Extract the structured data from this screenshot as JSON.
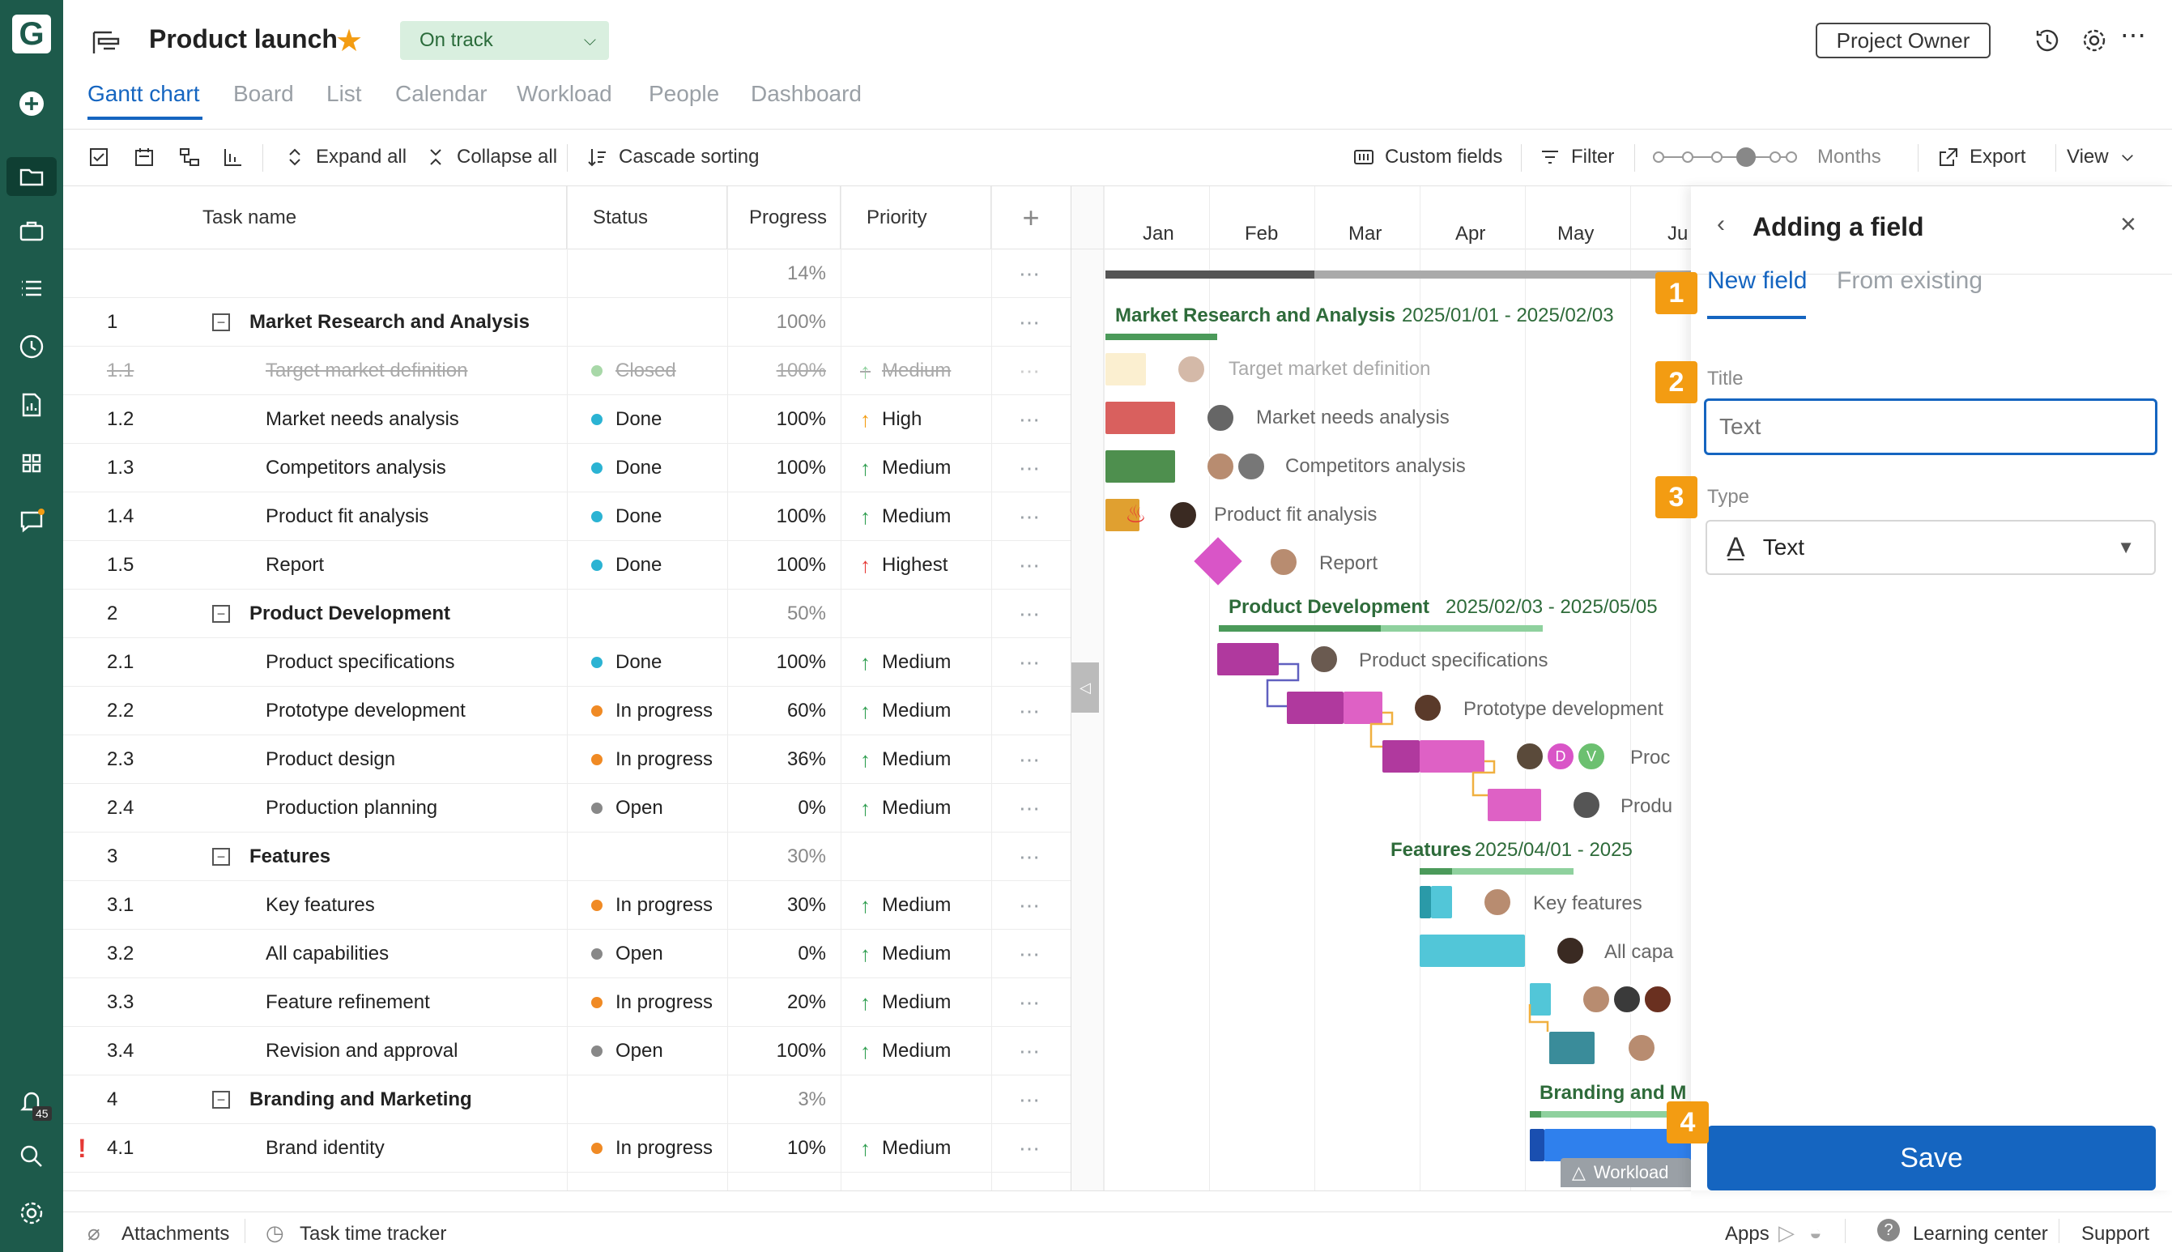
{
  "app": {
    "logo": "G",
    "title": "Product launch",
    "status": "On track",
    "owner_btn": "Project Owner",
    "notif_count": "45"
  },
  "tabs": [
    "Gantt chart",
    "Board",
    "List",
    "Calendar",
    "Workload",
    "People",
    "Dashboard"
  ],
  "toolbar": {
    "expand": "Expand all",
    "collapse": "Collapse all",
    "cascade": "Cascade sorting",
    "custom": "Custom fields",
    "filter": "Filter",
    "zoom": "Months",
    "export": "Export",
    "view": "View"
  },
  "columns": {
    "task": "Task name",
    "status": "Status",
    "progress": "Progress",
    "priority": "Priority"
  },
  "summary_progress": "14%",
  "rows": [
    {
      "num": "1",
      "name": "Market Research and Analysis",
      "status": "",
      "progress": "100%",
      "priority": "",
      "group": true,
      "dot": "",
      "pcolor": ""
    },
    {
      "num": "1.1",
      "name": "Target market definition",
      "status": "Closed",
      "progress": "100%",
      "priority": "Medium",
      "group": false,
      "dot": "#a8d8a8",
      "pcolor": "#8fd19e",
      "closed": true
    },
    {
      "num": "1.2",
      "name": "Market needs analysis",
      "status": "Done",
      "progress": "100%",
      "priority": "High",
      "group": false,
      "dot": "#2bb3d3",
      "pcolor": "#f39c12"
    },
    {
      "num": "1.3",
      "name": "Competitors analysis",
      "status": "Done",
      "progress": "100%",
      "priority": "Medium",
      "group": false,
      "dot": "#2bb3d3",
      "pcolor": "#2e9e4f"
    },
    {
      "num": "1.4",
      "name": "Product fit analysis",
      "status": "Done",
      "progress": "100%",
      "priority": "Medium",
      "group": false,
      "dot": "#2bb3d3",
      "pcolor": "#2e9e4f"
    },
    {
      "num": "1.5",
      "name": "Report",
      "status": "Done",
      "progress": "100%",
      "priority": "Highest",
      "group": false,
      "dot": "#2bb3d3",
      "pcolor": "#e53935"
    },
    {
      "num": "2",
      "name": "Product Development",
      "status": "",
      "progress": "50%",
      "priority": "",
      "group": true,
      "dot": "",
      "pcolor": ""
    },
    {
      "num": "2.1",
      "name": "Product specifications",
      "status": "Done",
      "progress": "100%",
      "priority": "Medium",
      "group": false,
      "dot": "#2bb3d3",
      "pcolor": "#2e9e4f"
    },
    {
      "num": "2.2",
      "name": "Prototype development",
      "status": "In progress",
      "progress": "60%",
      "priority": "Medium",
      "group": false,
      "dot": "#f08a24",
      "pcolor": "#2e9e4f"
    },
    {
      "num": "2.3",
      "name": "Product design",
      "status": "In progress",
      "progress": "36%",
      "priority": "Medium",
      "group": false,
      "dot": "#f08a24",
      "pcolor": "#2e9e4f"
    },
    {
      "num": "2.4",
      "name": "Production planning",
      "status": "Open",
      "progress": "0%",
      "priority": "Medium",
      "group": false,
      "dot": "#888",
      "pcolor": "#2e9e4f"
    },
    {
      "num": "3",
      "name": "Features",
      "status": "",
      "progress": "30%",
      "priority": "",
      "group": true,
      "dot": "",
      "pcolor": ""
    },
    {
      "num": "3.1",
      "name": "Key features",
      "status": "In progress",
      "progress": "30%",
      "priority": "Medium",
      "group": false,
      "dot": "#f08a24",
      "pcolor": "#2e9e4f"
    },
    {
      "num": "3.2",
      "name": "All capabilities",
      "status": "Open",
      "progress": "0%",
      "priority": "Medium",
      "group": false,
      "dot": "#888",
      "pcolor": "#2e9e4f"
    },
    {
      "num": "3.3",
      "name": "Feature refinement",
      "status": "In progress",
      "progress": "20%",
      "priority": "Medium",
      "group": false,
      "dot": "#f08a24",
      "pcolor": "#2e9e4f"
    },
    {
      "num": "3.4",
      "name": "Revision and approval",
      "status": "Open",
      "progress": "100%",
      "priority": "Medium",
      "group": false,
      "dot": "#888",
      "pcolor": "#2e9e4f"
    },
    {
      "num": "4",
      "name": "Branding and Marketing",
      "status": "",
      "progress": "3%",
      "priority": "",
      "group": true,
      "dot": "",
      "pcolor": ""
    },
    {
      "num": "4.1",
      "name": "Brand identity",
      "status": "In progress",
      "progress": "10%",
      "priority": "Medium",
      "group": false,
      "dot": "#f08a24",
      "pcolor": "#2e9e4f",
      "flag": true
    }
  ],
  "months": [
    "Jan",
    "Feb",
    "Mar",
    "Apr",
    "May",
    "Ju"
  ],
  "gantt": {
    "g1": "Market Research and Analysis",
    "g1d": "2025/01/01 - 2025/02/03",
    "g2": "Product Development",
    "g2d": "2025/02/03 - 2025/05/05",
    "g3": "Features",
    "g3d": "2025/04/01 - 2025",
    "g4": "Branding and M",
    "l11": "Target market definition",
    "l12": "Market needs analysis",
    "l13": "Competitors analysis",
    "l14": "Product fit analysis",
    "l15": "Report",
    "l21": "Product specifications",
    "l22": "Prototype development",
    "l23": "Proc",
    "l24": "Produ",
    "l31": "Key features",
    "l32": "All capa",
    "av_d": "D",
    "av_v": "V",
    "workload": "Workload"
  },
  "panel": {
    "title": "Adding a field",
    "tab_new": "New field",
    "tab_existing": "From existing",
    "title_label": "Title",
    "title_placeholder": "Text",
    "type_label": "Type",
    "type_value": "Text",
    "save": "Save",
    "b1": "1",
    "b2": "2",
    "b3": "3",
    "b4": "4"
  },
  "footer": {
    "attachments": "Attachments",
    "tracker": "Task time tracker",
    "apps": "Apps",
    "learning": "Learning center",
    "support": "Support"
  }
}
